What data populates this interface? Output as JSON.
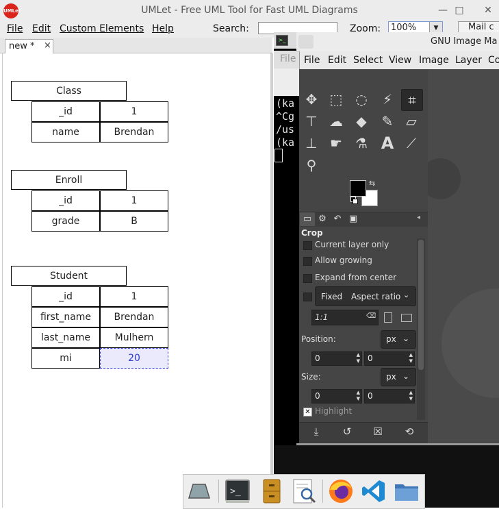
{
  "umlet": {
    "title": "UMLet - Free UML Tool for Fast UML Diagrams",
    "logo_text": "UMLet",
    "window_buttons": [
      "—",
      "□",
      "✕"
    ],
    "menu": [
      "File",
      "Edit",
      "Custom Elements",
      "Help"
    ],
    "search_label": "Search:",
    "search_value": "",
    "zoom_label": "Zoom:",
    "zoom_value": "100%",
    "mail_label": "Mail c",
    "tab": {
      "label": "new *",
      "close": "×"
    },
    "classes": [
      {
        "title": "Class",
        "rows": [
          [
            "_id",
            "1"
          ],
          [
            "name",
            "Brendan"
          ]
        ]
      },
      {
        "title": "Enroll",
        "rows": [
          [
            "_id",
            "1"
          ],
          [
            "grade",
            "B"
          ]
        ]
      },
      {
        "title": "Student",
        "rows": [
          [
            "_id",
            "1"
          ],
          [
            "first_name",
            "Brendan"
          ],
          [
            "last_name",
            "Mulhern"
          ],
          [
            "mi",
            "20"
          ]
        ]
      }
    ]
  },
  "terminal": {
    "menu_file": "File",
    "lines": [
      "(ka",
      "^Cg",
      "/us",
      "(ka"
    ]
  },
  "gimp": {
    "title": "GNU Image Ma",
    "menu": [
      "File",
      "Edit",
      "Select",
      "View",
      "Image",
      "Layer",
      "Co"
    ],
    "tools": [
      "move-icon",
      "rect-select-icon",
      "lasso-icon",
      "fuzzy-select-icon",
      "crop-icon",
      "align-icon",
      "warp-icon",
      "bucket-fill-icon",
      "paintbrush-icon",
      "eraser-icon",
      "clone-icon",
      "smudge-icon",
      "dodge-icon",
      "text-icon",
      "color-picker-icon",
      "zoom-icon"
    ],
    "fg_color": "#000000",
    "bg_color": "#ffffff",
    "tool_options": {
      "title": "Crop",
      "current_layer_only": "Current layer only",
      "allow_growing": "Allow growing",
      "expand_from_center": "Expand from center",
      "fixed_label": "Fixed",
      "fixed_value": "Aspect ratio",
      "ratio_value": "1:1",
      "position_label": "Position:",
      "position_unit": "px",
      "position_x": "0",
      "position_y": "0",
      "size_label": "Size:",
      "size_unit": "px",
      "size_x": "0",
      "size_y": "0",
      "highlight": "Highlight"
    }
  },
  "taskbar": {
    "apps": [
      "desktop-icon",
      "terminal-icon",
      "file-cabinet-icon",
      "document-viewer-icon",
      "firefox-icon",
      "vscode-icon",
      "folder-icon"
    ]
  }
}
